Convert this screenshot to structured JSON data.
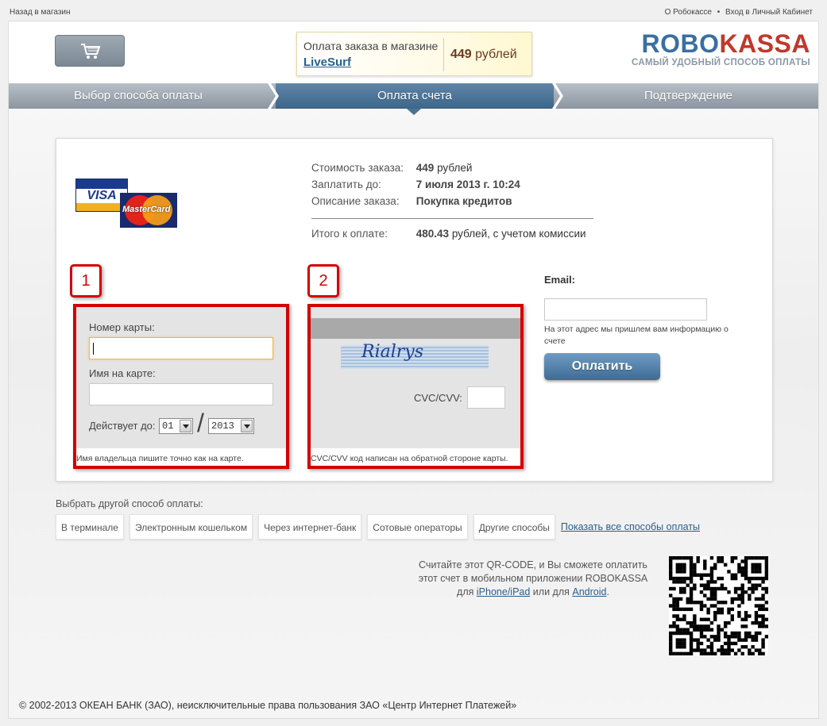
{
  "topbar": {
    "back": "Назад в магазин",
    "about": "О Робокассе",
    "dot": "•",
    "login": "Вход в Личный Кабинет"
  },
  "header": {
    "order_label": "Оплата заказа в магазине",
    "shop_name": "LiveSurf",
    "amount_value": "449",
    "amount_unit": "рублей",
    "logo_robo": "ROBO",
    "logo_kassa": "KASSA",
    "logo_tagline": "САМЫЙ УДОБНЫЙ СПОСОБ ОПЛАТЫ"
  },
  "steps": [
    {
      "label": "Выбор способа оплаты",
      "active": false
    },
    {
      "label": "Оплата счета",
      "active": true
    },
    {
      "label": "Подтверждение",
      "active": false
    }
  ],
  "card_logos": {
    "visa": "VISA",
    "mastercard": "MasterCard"
  },
  "order_info": {
    "cost_label": "Стоимость заказа:",
    "cost_value": "449",
    "cost_unit": "рублей",
    "due_label": "Заплатить до:",
    "due_value": "7 июля 2013 г. 10:24",
    "desc_label": "Описание заказа:",
    "desc_value": "Покупка кредитов",
    "total_label": "Итого к оплате:",
    "total_value": "480.43",
    "total_suffix": "рублей, с учетом комиссии"
  },
  "badges": {
    "one": "1",
    "two": "2"
  },
  "card_form": {
    "card_number_label": "Номер карты:",
    "card_number_value": "",
    "holder_label": "Имя на карте:",
    "holder_value": "",
    "valid_label": "Действует до:",
    "month": "01",
    "slash": "/",
    "year": "2013",
    "note": "Имя владельца пишите точно как на карте."
  },
  "cvc_form": {
    "signature": "Rialrys",
    "cvc_label": "CVC/CVV:",
    "cvc_value": "",
    "note": "CVC/CVV код написан на обратной стороне карты."
  },
  "email": {
    "label": "Email:",
    "value": "",
    "note": "На этот адрес мы пришлем вам информацию о счете"
  },
  "pay_button": "Оплатить",
  "other_methods": {
    "label": "Выбрать другой способ оплаты:",
    "items": [
      "В терминале",
      "Электронным кошельком",
      "Через интернет-банк",
      "Сотовые операторы",
      "Другие способы"
    ],
    "show_all": "Показать все способы оплаты"
  },
  "qr": {
    "text1": "Считайте этот QR-CODE, и Вы сможете оплатить",
    "text2": "этот счет в мобильном приложении ROBOKASSA",
    "text3a": "для",
    "iphone": "iPhone/iPad",
    "text3b": "или для",
    "android": "Android",
    "text3c": "."
  },
  "footer": "© 2002-2013 ОКЕАН БАНК (ЗАО), неисключительные права пользования ЗАО «Центр Интернет Платежей»",
  "colors": {
    "accent": "#3a6fa3",
    "brand_red": "#c0392b",
    "highlight_red": "#d40000"
  }
}
